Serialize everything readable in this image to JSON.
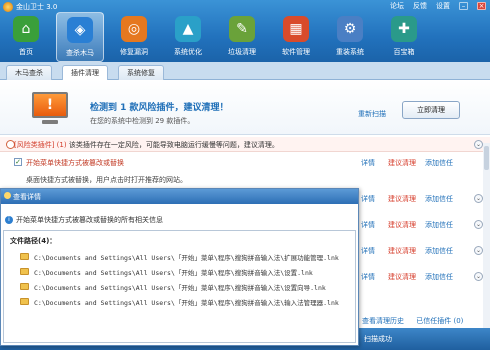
{
  "app": {
    "title": "金山卫士 3.0"
  },
  "topbar": {
    "items": [
      "论坛",
      "反馈",
      "设置"
    ]
  },
  "toolbar": {
    "tools": [
      {
        "label": "首页",
        "icon": "home-icon",
        "color": "#3a9f3a"
      },
      {
        "label": "查杀木马",
        "icon": "shield-icon",
        "color": "#2a7fd4"
      },
      {
        "label": "修复漏洞",
        "icon": "patch-icon",
        "color": "#e5781f"
      },
      {
        "label": "系统优化",
        "icon": "rocket-icon",
        "color": "#2aa0c8"
      },
      {
        "label": "垃圾清理",
        "icon": "broom-icon",
        "color": "#6aa23a"
      },
      {
        "label": "软件管理",
        "icon": "apps-icon",
        "color": "#d94b2b"
      },
      {
        "label": "重装系统",
        "icon": "gear-icon",
        "color": "#4a7fc4"
      },
      {
        "label": "百宝箱",
        "icon": "toolbox-icon",
        "color": "#2a9a8a"
      }
    ]
  },
  "subtabs": [
    "木马查杀",
    "插件清理",
    "系统修复"
  ],
  "summary": {
    "headline": "检测到 1 款风险插件，建议清理！",
    "subline": "在您的系统中检测到 29 款插件。",
    "rescan": "重新扫描",
    "clean_button": "立即清理"
  },
  "risk": {
    "prefix": "[风险类插件] (1)",
    "text": " 该类插件存在一定风险，可能导致电脑运行缓慢等问题，建议清理。"
  },
  "rows": [
    {
      "name": "开始菜单快捷方式被篡改或替换",
      "desc": "桌面快捷方式被替换，用户点击时打开推荐的网站。"
    }
  ],
  "actions": {
    "detail": "详情",
    "keep": "建议清理",
    "trust": "添加信任"
  },
  "dialog": {
    "title": "查看详情",
    "info": "开始菜单快捷方式被篡改或替换的所有相关信息",
    "path_header": "文件路径(4)：",
    "paths": [
      "C:\\Documents and Settings\\All Users\\「开始」菜单\\程序\\搜狗拼音输入法\\扩展功能管理.lnk",
      "C:\\Documents and Settings\\All Users\\「开始」菜单\\程序\\搜狗拼音输入法\\设置.lnk",
      "C:\\Documents and Settings\\All Users\\「开始」菜单\\程序\\搜狗拼音输入法\\设置向导.lnk",
      "C:\\Documents and Settings\\All Users\\「开始」菜单\\程序\\搜狗拼音输入法\\输入法管理器.lnk"
    ]
  },
  "footer": {
    "history": "查看清理历史",
    "trusted": "已信任插件 (0)",
    "status": "扫描成功"
  }
}
